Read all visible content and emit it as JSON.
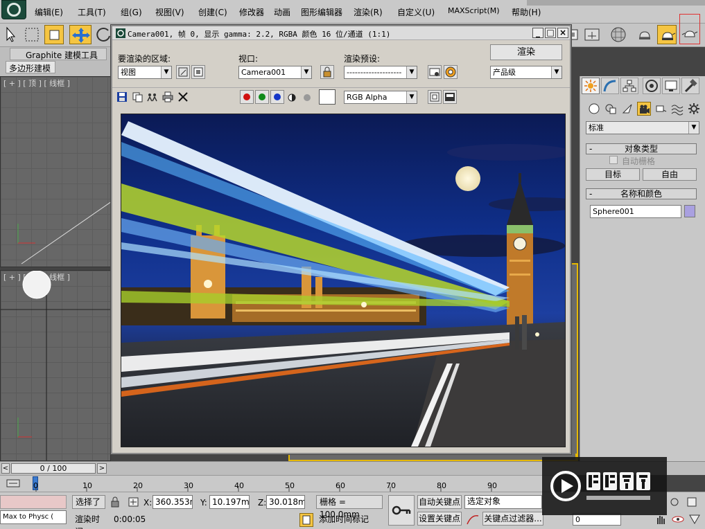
{
  "menubar": {
    "items": [
      "编辑(E)",
      "工具(T)",
      "组(G)",
      "视图(V)",
      "创建(C)",
      "修改器",
      "动画",
      "图形编辑器",
      "渲染(R)",
      "自定义(U)",
      "MAXScript(M)",
      "帮助(H)"
    ]
  },
  "ribbon": {
    "graphite_tab": "Graphite 建模工具",
    "poly_tab": "多边形建模"
  },
  "viewports": {
    "top_label": "[ + ] [ 顶 ] [ 线框 ]",
    "front_label": "[ + ] [ 前 ] [ 线框 ]"
  },
  "render_window": {
    "title": "Camera001, 帧 0, 显示 gamma: 2.2, RGBA 颜色 16 位/通道 (1:1)",
    "area_label": "要渲染的区域:",
    "area_value": "视图",
    "viewport_label": "视口:",
    "viewport_value": "Camera001",
    "preset_label": "渲染预设:",
    "preset_value": "--------------------",
    "render_button": "渲染",
    "quality_value": "产品级",
    "channel_value": "RGB Alpha",
    "colors": {
      "red": "#d01010",
      "green": "#0f8a1a",
      "blue": "#1436c8"
    }
  },
  "command_panel": {
    "dropdown_value": "标准",
    "rollout_object_type": "对象类型",
    "auto_grid_label": "自动栅格",
    "target_button": "目标",
    "free_button": "自由",
    "rollout_name_color": "名称和颜色",
    "name_value": "Sphere001",
    "object_color": "#a9a0e0"
  },
  "timeline": {
    "frame_counter": "0 / 100",
    "ticks": [
      "0",
      "10",
      "20",
      "30",
      "40",
      "50",
      "60",
      "70",
      "80",
      "90"
    ]
  },
  "statusbar": {
    "selected_label": "选择了",
    "x_label": "X:",
    "x_value": "360.353mm",
    "y_label": "Y:",
    "y_value": "10.197mm",
    "z_label": "Z:",
    "z_value": "30.018mm",
    "grid_value": "栅格 = 100.0mm",
    "auto_key": "自动关键点",
    "selected_object": "选定对象",
    "set_key": "设置关键点",
    "key_filters": "关键点过滤器...",
    "script_text": "Max to Physc (",
    "render_time_label": "渲染时间",
    "render_time_value": "0:00:05",
    "add_time_tag": "添加时间标记",
    "frame_field": "0"
  },
  "watermark": {
    "brand": "溜溜自学",
    "url": "ZIXUE.3D66.COM"
  }
}
